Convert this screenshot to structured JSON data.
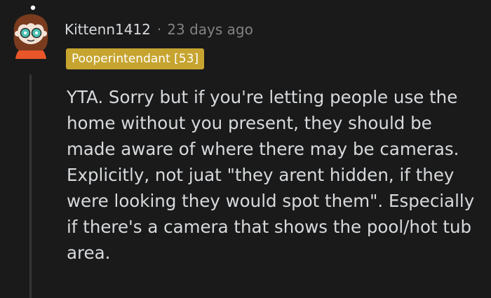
{
  "comment": {
    "username": "Kittenn1412",
    "separator": "·",
    "timestamp": "23 days ago",
    "flair": "Pooperintendant [53]",
    "body": "YTA. Sorry but if you're letting people use the home without you present, they should be made aware of where there may be cameras. Explicitly, not juat \"they arent hidden, if they were looking they would spot them\". Especially if there's a camera that shows the pool/hot tub area."
  },
  "colors": {
    "background": "#1a1a1b",
    "text": "#d7dadc",
    "muted": "#818384",
    "flair": "#c6a42f",
    "thread_line": "#343536"
  },
  "icons": {
    "avatar": "user-avatar-icon"
  }
}
